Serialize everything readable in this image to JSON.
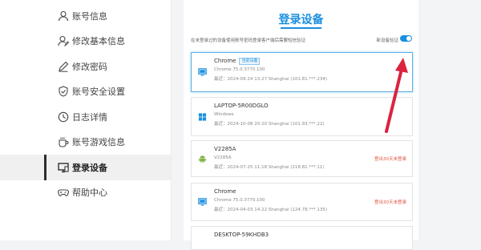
{
  "sidebar": {
    "items": [
      {
        "label": "账号信息",
        "icon": "user-icon"
      },
      {
        "label": "修改基本信息",
        "icon": "user-edit-icon"
      },
      {
        "label": "修改密码",
        "icon": "pencil-icon"
      },
      {
        "label": "账号安全设置",
        "icon": "shield-icon"
      },
      {
        "label": "日志详情",
        "icon": "clock-icon"
      },
      {
        "label": "账号游戏信息",
        "icon": "cup-icon"
      },
      {
        "label": "登录设备",
        "icon": "monitor-icon",
        "active": true
      },
      {
        "label": "帮助中心",
        "icon": "game-controller-icon"
      }
    ]
  },
  "main": {
    "title": "登录设备",
    "tip": "在未登录过的设备使用账号密码登录客户端后需要短信验证",
    "verify_label": "新设备验证",
    "verify_enabled": true,
    "accent": "#1a8fe0",
    "devices": [
      {
        "name": "Chrome",
        "badge": "当前设备",
        "os": "Chrome 75.0.3770.100",
        "login": "最近：2024-09-24 13:27   Shanghai  (101.81.***.234)",
        "logout": "",
        "icon": "monitor-icon"
      },
      {
        "name": "LAPTOP-5R00DGLO",
        "badge": "",
        "os": "Windows",
        "login": "最近：2024-10-08 20:20   Shanghai  (101.93.***.22)",
        "logout": "",
        "icon": "windows-icon"
      },
      {
        "name": "V2285A",
        "badge": "",
        "os": "V2285A",
        "login": "最近：2024-07-25 11:18   Shanghai  (218.81.***.11)",
        "logout": "登出30天未登录",
        "icon": "android-icon"
      },
      {
        "name": "Chrome",
        "badge": "",
        "os": "Chrome 75.0.3770.100",
        "login": "最近：2024-04-03 14:22   Shanghai  (124.78.***.135)",
        "logout": "登出30天未登录",
        "icon": "monitor-icon"
      },
      {
        "name": "DESKTOP-59KHDB3",
        "badge": "",
        "os": "",
        "login": "",
        "logout": "",
        "icon": "windows-icon"
      }
    ]
  },
  "annotation": {
    "icon": "red-arrow-icon",
    "color": "#d9233f"
  }
}
